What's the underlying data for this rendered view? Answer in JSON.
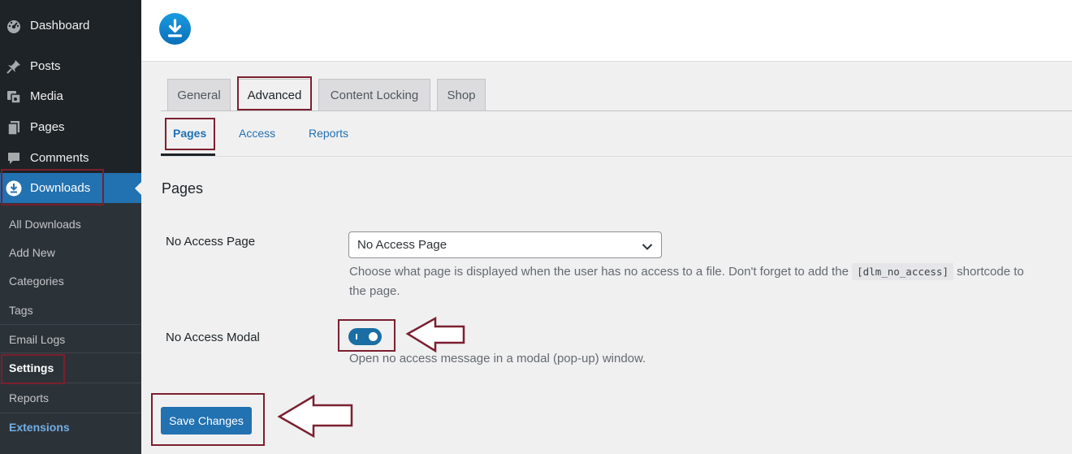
{
  "sidebar": {
    "items": [
      {
        "label": "Dashboard",
        "icon": "dashboard-icon"
      },
      {
        "label": "Posts",
        "icon": "pin-icon"
      },
      {
        "label": "Media",
        "icon": "media-icon"
      },
      {
        "label": "Pages",
        "icon": "pages-icon"
      },
      {
        "label": "Comments",
        "icon": "comment-icon"
      },
      {
        "label": "Downloads",
        "icon": "download-icon"
      }
    ],
    "submenu": [
      "All Downloads",
      "Add New",
      "Categories",
      "Tags",
      "Email Logs",
      "Settings",
      "Reports",
      "Extensions"
    ]
  },
  "header": {
    "logo": "download-logo-icon"
  },
  "tabs": [
    "General",
    "Advanced",
    "Content Locking",
    "Shop"
  ],
  "subtabs": [
    "Pages",
    "Access",
    "Reports"
  ],
  "section": {
    "title": "Pages"
  },
  "no_access_page": {
    "label": "No Access Page",
    "selected": "No Access Page",
    "desc_before": "Choose what page is displayed when the user has no access to a file. Don't forget to add the",
    "desc_code": "[dlm_no_access]",
    "desc_after": "shortcode to",
    "desc_line2": "the page."
  },
  "no_access_modal": {
    "label": "No Access Modal",
    "enabled": true,
    "desc": "Open no access message in a modal (pop-up) window."
  },
  "save_label": "Save Changes",
  "colors": {
    "accent": "#2271b1",
    "highlight": "#7b1f2f",
    "sidebar": "#1d2327"
  }
}
